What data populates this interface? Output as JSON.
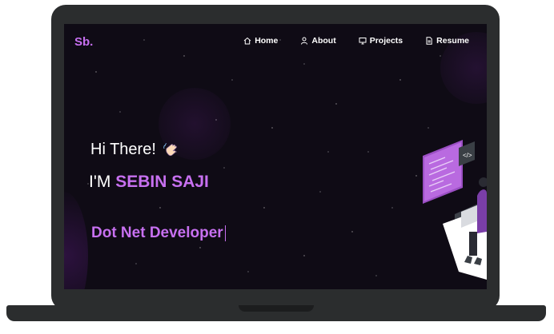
{
  "brand": {
    "logo": "Sb."
  },
  "nav": {
    "items": [
      {
        "label": "Home",
        "icon": "home-icon"
      },
      {
        "label": "About",
        "icon": "user-icon"
      },
      {
        "label": "Projects",
        "icon": "monitor-icon"
      },
      {
        "label": "Resume",
        "icon": "document-icon"
      }
    ]
  },
  "hero": {
    "greeting": "Hi There!",
    "greeting_icon": "waving-hand-icon",
    "intro_prefix": "I'M",
    "name": "SEBIN SAJI",
    "role": "Dot Net Developer",
    "code_tag": "</>"
  },
  "colors": {
    "accent": "#c770f0",
    "background": "#0f0b15",
    "text": "#ffffff",
    "laptop_frame": "#2b2d2e"
  }
}
